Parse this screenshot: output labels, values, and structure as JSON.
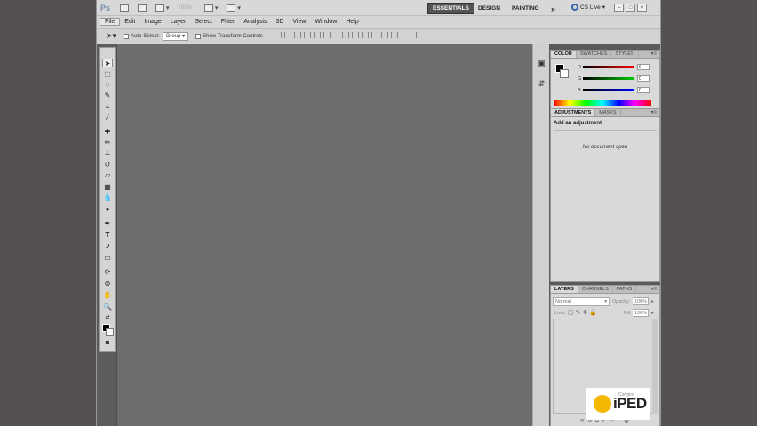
{
  "app": {
    "logo": "Ps",
    "zoom": "100%",
    "workspaces": [
      "ESSENTIALS",
      "DESIGN",
      "PAINTING"
    ],
    "more_workspaces": "»",
    "cs_live": "CS Live"
  },
  "menu": [
    "File",
    "Edit",
    "Image",
    "Layer",
    "Select",
    "Filter",
    "Analysis",
    "3D",
    "View",
    "Window",
    "Help"
  ],
  "options_bar": {
    "auto_select_label": "Auto-Select:",
    "auto_select_value": "Group",
    "show_transform_label": "Show Transform Controls"
  },
  "color_panel": {
    "tabs": [
      "COLOR",
      "SWATCHES",
      "STYLES"
    ],
    "channels": [
      {
        "label": "R",
        "value": "0"
      },
      {
        "label": "G",
        "value": "0"
      },
      {
        "label": "B",
        "value": "0"
      }
    ]
  },
  "adjustments_panel": {
    "tabs": [
      "ADJUSTMENTS",
      "MASKS"
    ],
    "title": "Add an adjustment",
    "message": "No document open"
  },
  "layers_panel": {
    "tabs": [
      "LAYERS",
      "CHANNELS",
      "PATHS"
    ],
    "blend_mode": "Normal",
    "opacity_label": "Opacity:",
    "opacity_value": "100%",
    "lock_label": "Lock:",
    "fill_label": "Fill:",
    "fill_value": "100%"
  },
  "watermark": {
    "brand": "iPED",
    "tagline": "Compro"
  },
  "colors": {
    "workspace_active": "#555555",
    "canvas": "#6d6d6d",
    "brand_yellow": "#f5b800"
  }
}
